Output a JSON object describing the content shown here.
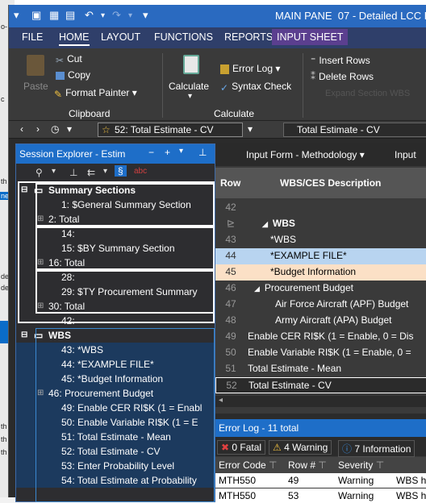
{
  "background": {
    "left_fragments": [
      "o-",
      "c",
      "th",
      "ne",
      "de",
      "de",
      "th",
      "th",
      "th"
    ]
  },
  "titlebar": {
    "main_pane": "MAIN PANE",
    "doc_title": "07 - Detailed LCC E"
  },
  "menu": {
    "items": [
      "FILE",
      "HOME",
      "LAYOUT",
      "FUNCTIONS",
      "REPORTS",
      "INPUT SHEET"
    ]
  },
  "ribbon": {
    "paste": "Paste",
    "cut": "Cut",
    "copy": "Copy",
    "format_painter": "Format Painter",
    "clipboard_group": "Clipboard",
    "calculate": "Calculate",
    "error_log": "Error Log",
    "syntax_check": "Syntax Check",
    "calculate_group": "Calculate",
    "insert_rows": "Insert Rows",
    "delete_rows": "Delete Rows",
    "expand_wbs": "Expand Section WBS"
  },
  "navbar": {
    "nav_value": "52: Total Estimate - CV",
    "nav_right": "Total Estimate - CV"
  },
  "session": {
    "title": "Session Explorer - Estim",
    "groups": [
      {
        "label": "Summary Sections"
      },
      {
        "label": "WBS"
      }
    ],
    "items": [
      "1: $General Summary Section",
      "2: Total",
      "14:",
      "15: $BY Summary Section",
      "16: Total",
      "28:",
      "29: $TY Procurement Summary",
      "30: Total",
      "42:",
      "43: *WBS",
      "44: *EXAMPLE FILE*",
      "45: *Budget Information",
      "46: Procurement Budget",
      "49: Enable CER RI$K (1 = Enabl",
      "50: Enable Variable RI$K (1 = E",
      "51: Total Estimate - Mean",
      "52: Total Estimate - CV",
      "53: Enter Probability Level",
      "54: Total Estimate at Probability"
    ]
  },
  "grid": {
    "tab1": "Input Form - Methodology",
    "tab2": "Input",
    "col_row": "Row",
    "col_desc": "WBS/CES Description",
    "rows": [
      {
        "n": "42",
        "d": ""
      },
      {
        "n": "",
        "d": "WBS"
      },
      {
        "n": "43",
        "d": "*WBS"
      },
      {
        "n": "44",
        "d": "*EXAMPLE FILE*"
      },
      {
        "n": "45",
        "d": "*Budget Information"
      },
      {
        "n": "46",
        "d": "Procurement Budget"
      },
      {
        "n": "47",
        "d": "Air Force Aircraft (APF) Budget"
      },
      {
        "n": "48",
        "d": "Army Aircraft (APA) Budget"
      },
      {
        "n": "49",
        "d": "Enable CER RI$K (1 = Enable, 0 = Dis"
      },
      {
        "n": "50",
        "d": "Enable Variable RI$K (1 = Enable, 0 ="
      },
      {
        "n": "51",
        "d": "Total Estimate - Mean"
      },
      {
        "n": "52",
        "d": "Total Estimate - CV"
      }
    ]
  },
  "errlog": {
    "title": "Error Log",
    "count": "11 total",
    "fatal": "0 Fatal",
    "warning": "4 Warning",
    "info": "7 Information",
    "cols": [
      "Error Code",
      "Row #",
      "Severity"
    ],
    "rows": [
      {
        "code": "MTH550",
        "row": "49",
        "sev": "Warning",
        "desc": "WBS h"
      },
      {
        "code": "MTH550",
        "row": "53",
        "sev": "Warning",
        "desc": "WBS h"
      }
    ]
  }
}
